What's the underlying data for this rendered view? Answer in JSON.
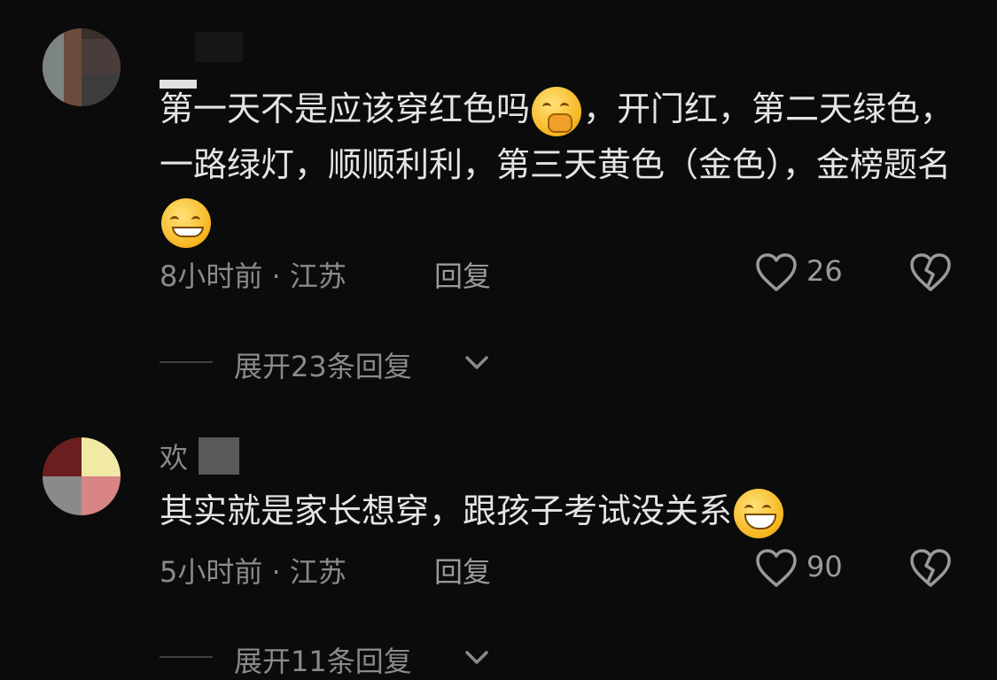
{
  "comments": [
    {
      "username": "",
      "text_parts": [
        "第一天不是应该穿红色吗",
        "，开门红，第二天绿色，一路绿灯，顺顺利利，第三天黄色（金色），金榜题名"
      ],
      "emojis": [
        "cover-mouth-emoji",
        "squint-smirk-emoji"
      ],
      "time_location": "8小时前 · 江苏",
      "reply_label": "回复",
      "likes": "26",
      "expand_label": "展开23条回复"
    },
    {
      "username": "欢",
      "text": "其实就是家长想穿，跟孩子考试没关系",
      "emojis": [
        "grin-emoji"
      ],
      "time_location": "5小时前 · 江苏",
      "reply_label": "回复",
      "likes": "90",
      "expand_label": "展开11条回复"
    }
  ],
  "icons": {
    "like": "heart-outline-icon",
    "dislike": "broken-heart-icon",
    "expand": "chevron-down-icon"
  },
  "colors": {
    "background": "#0b0b0b",
    "text": "#e4e4e4",
    "muted": "#8a8a8a"
  }
}
